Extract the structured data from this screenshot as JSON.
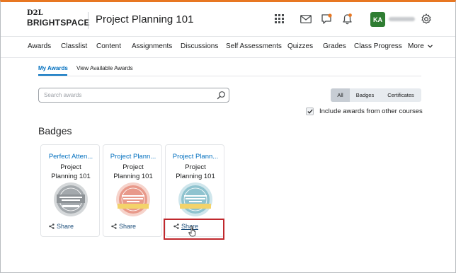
{
  "header": {
    "logo_top": "D2L",
    "logo_bottom": "BRIGHTSPACE",
    "course_title": "Project Planning 101",
    "avatar_initials": "KA",
    "icons": [
      "grid-icon",
      "mail-icon",
      "chat-icon",
      "bell-icon",
      "gear-icon"
    ],
    "accent_color": "#e87722"
  },
  "nav": {
    "items": [
      "Awards",
      "Classlist",
      "Content",
      "Assignments",
      "Discussions",
      "Self Assessments",
      "Quizzes",
      "Grades",
      "Class Progress",
      "More"
    ]
  },
  "tabs": {
    "my_awards": "My Awards",
    "view_available": "View Available Awards"
  },
  "search": {
    "placeholder": "Search awards"
  },
  "filters": [
    "All",
    "Badges",
    "Certificates"
  ],
  "include_other": {
    "label": "Include awards from other courses",
    "checked": true
  },
  "section_heading": "Badges",
  "badges": [
    {
      "title": "Perfect Atten...",
      "course_line1": "Project",
      "course_line2": "Planning 101",
      "share": "Share",
      "color": "#a4a9ad",
      "ribbon": "#d5d8da"
    },
    {
      "title": "Project Plann...",
      "course_line1": "Project",
      "course_line2": "Planning 101",
      "share": "Share",
      "color": "#e8998a",
      "ribbon": "#f3d36a"
    },
    {
      "title": "Project Plann...",
      "course_line1": "Project",
      "course_line2": "Planning 101",
      "share": "Share",
      "color": "#8fc3cf",
      "ribbon": "#f3d36a"
    }
  ]
}
